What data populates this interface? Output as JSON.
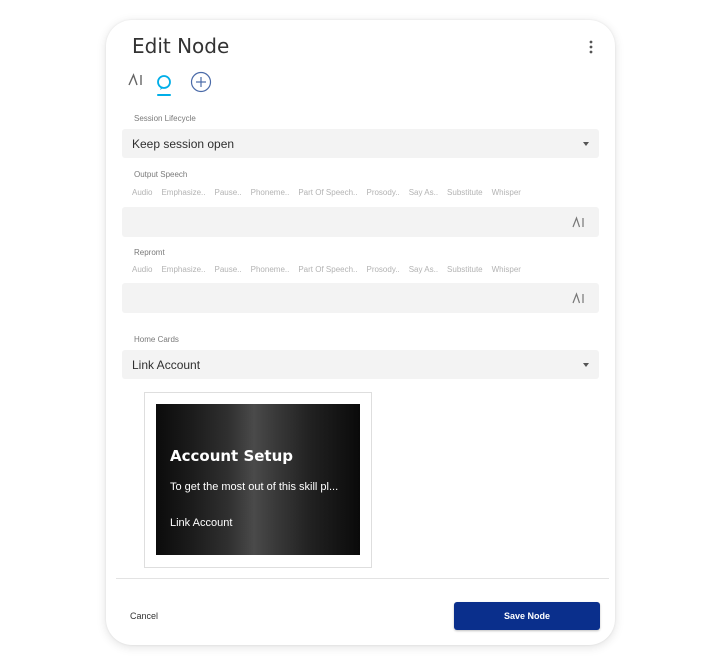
{
  "dialog": {
    "title": "Edit Node",
    "more_icon": "more-vertical-icon"
  },
  "tabs": [
    {
      "icon": "ai-icon",
      "active": false
    },
    {
      "icon": "alexa-ring-icon",
      "active": true
    },
    {
      "icon": "add-circle-icon",
      "active": false
    }
  ],
  "session": {
    "label": "Session Lifecycle",
    "value": "Keep session open"
  },
  "output_speech": {
    "label": "Output Speech",
    "tools": [
      "Audio",
      "Emphasize..",
      "Pause..",
      "Phoneme..",
      "Part Of Speech..",
      "Prosody..",
      "Say As..",
      "Substitute",
      "Whisper"
    ],
    "value": ""
  },
  "reprompt": {
    "label": "Repromt",
    "tools": [
      "Audio",
      "Emphasize..",
      "Pause..",
      "Phoneme..",
      "Part Of Speech..",
      "Prosody..",
      "Say As..",
      "Substitute",
      "Whisper"
    ],
    "value": ""
  },
  "home_cards": {
    "label": "Home Cards",
    "value": "Link Account"
  },
  "card_preview": {
    "title": "Account Setup",
    "body": "To get the most out of this skill pl...",
    "link": "Link Account"
  },
  "footer": {
    "cancel_label": "Cancel",
    "save_label": "Save Node"
  },
  "colors": {
    "accent": "#00aee8",
    "primary_button": "#0a2f8c"
  }
}
